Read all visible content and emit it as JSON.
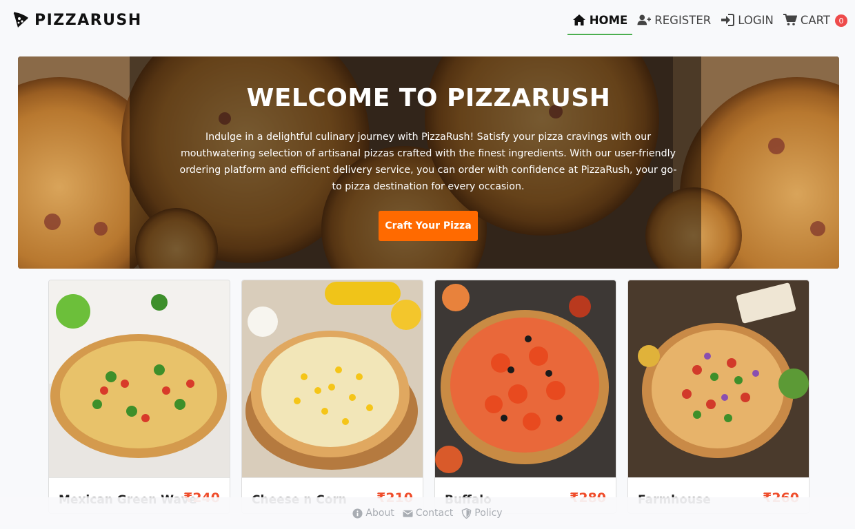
{
  "brand": {
    "name": "PIZZARUSH",
    "icon": "pizza-slice-icon"
  },
  "nav": {
    "home": "HOME",
    "register": "REGISTER",
    "login": "LOGIN",
    "cart": "CART",
    "cart_count": "0",
    "active": "home"
  },
  "hero": {
    "title": "WELCOME TO PIZZARUSH",
    "text": "Indulge in a delightful culinary journey with PizzaRush! Satisfy your pizza cravings with our mouthwatering selection of artisanal pizzas crafted with the finest ingredients. With our user-friendly ordering platform and efficient delivery service, you can order with confidence at PizzaRush, your go-to pizza destination for every occasion.",
    "cta": "Craft Your Pizza"
  },
  "products": [
    {
      "name": "Mexican Green Wave",
      "price": "₹240"
    },
    {
      "name": "Cheese n Corn",
      "price": "₹210"
    },
    {
      "name": "Buffalo",
      "price": "₹280"
    },
    {
      "name": "Farmhouse",
      "price": "₹260"
    }
  ],
  "footer": {
    "about": "About",
    "contact": "Contact",
    "policy": "Policy"
  },
  "colors": {
    "accent": "#ff6a00",
    "price": "#ef4c2a",
    "active_underline": "#4caf50",
    "badge": "#ee4b4b"
  }
}
